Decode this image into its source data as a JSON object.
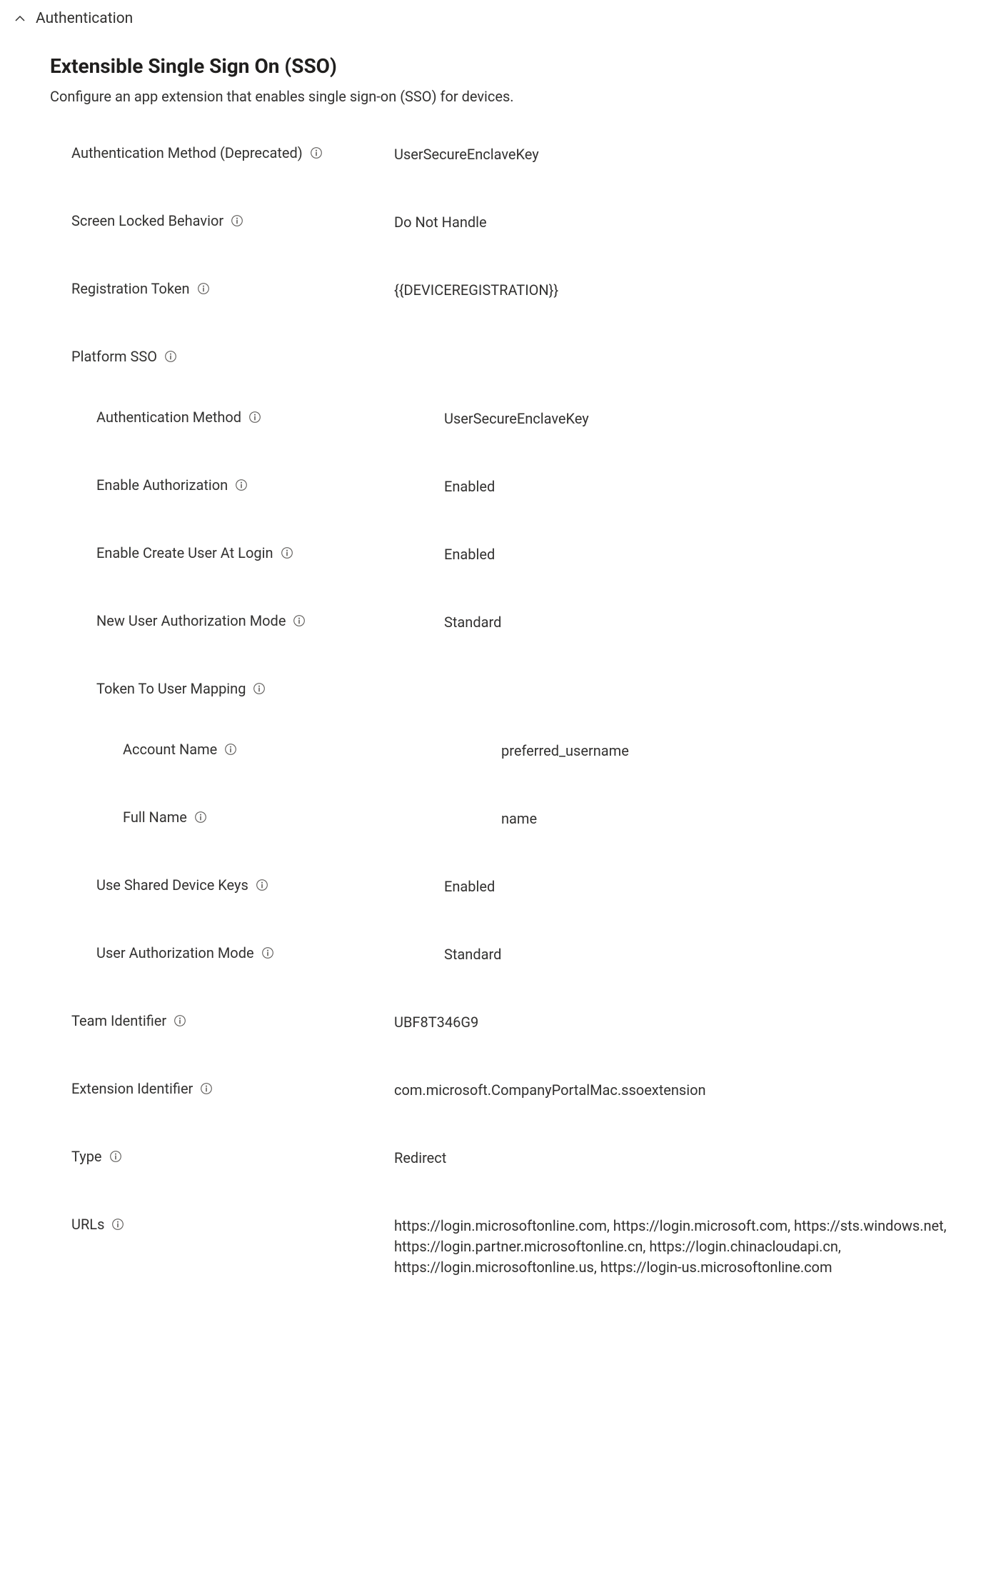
{
  "section": {
    "title": "Authentication"
  },
  "header": {
    "title": "Extensible Single Sign On (SSO)",
    "description": "Configure an app extension that enables single sign-on (SSO) for devices."
  },
  "fields": {
    "auth_method_deprecated": {
      "label": "Authentication Method (Deprecated)",
      "value": "UserSecureEnclaveKey"
    },
    "screen_locked_behavior": {
      "label": "Screen Locked Behavior",
      "value": "Do Not Handle"
    },
    "registration_token": {
      "label": "Registration Token",
      "value": "{{DEVICEREGISTRATION}}"
    },
    "platform_sso": {
      "label": "Platform SSO"
    },
    "psso_auth_method": {
      "label": "Authentication Method",
      "value": "UserSecureEnclaveKey"
    },
    "psso_enable_authorization": {
      "label": "Enable Authorization",
      "value": "Enabled"
    },
    "psso_enable_create_user": {
      "label": "Enable Create User At Login",
      "value": "Enabled"
    },
    "psso_new_user_auth_mode": {
      "label": "New User Authorization Mode",
      "value": "Standard"
    },
    "psso_token_to_user_mapping": {
      "label": "Token To User Mapping"
    },
    "ttum_account_name": {
      "label": "Account Name",
      "value": "preferred_username"
    },
    "ttum_full_name": {
      "label": "Full Name",
      "value": "name"
    },
    "psso_use_shared_device_keys": {
      "label": "Use Shared Device Keys",
      "value": "Enabled"
    },
    "psso_user_auth_mode": {
      "label": "User Authorization Mode",
      "value": "Standard"
    },
    "team_identifier": {
      "label": "Team Identifier",
      "value": "UBF8T346G9"
    },
    "extension_identifier": {
      "label": "Extension Identifier",
      "value": "com.microsoft.CompanyPortalMac.ssoextension"
    },
    "type": {
      "label": "Type",
      "value": "Redirect"
    },
    "urls": {
      "label": "URLs",
      "value": "https://login.microsoftonline.com, https://login.microsoft.com, https://sts.windows.net, https://login.partner.microsoftonline.cn, https://login.chinacloudapi.cn, https://login.microsoftonline.us, https://login-us.microsoftonline.com"
    }
  }
}
